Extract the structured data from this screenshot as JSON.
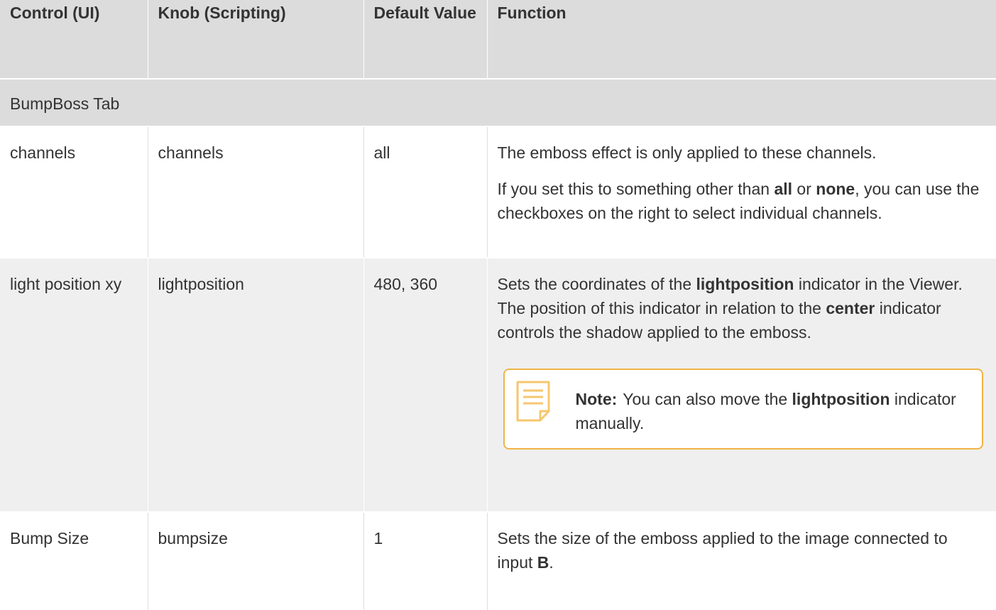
{
  "table": {
    "headers": {
      "control": "Control (UI)",
      "knob": "Knob (Scripting)",
      "default": "Default Value",
      "function": "Function"
    },
    "section_title": "BumpBoss Tab",
    "rows": [
      {
        "control": "channels",
        "knob": "channels",
        "default": "all",
        "function_p1": "The emboss effect is only applied to these channels.",
        "function_p2": {
          "t1": "If you set this to something other than ",
          "b1": "all",
          "t2": " or ",
          "b2": "none",
          "t3": ", you can use the checkboxes on the right to select individual channels."
        }
      },
      {
        "control": "light position xy",
        "knob": "lightposition",
        "default": "480, 360",
        "function_p1": {
          "t1": "Sets the coordinates of the ",
          "b1": "lightposition",
          "t2": " indicator in the Viewer. The position of this indicator in relation to the ",
          "b2": "center",
          "t3": " indicator controls the shadow applied to the emboss."
        },
        "note": {
          "label": "Note:",
          "t1": "You can also move the ",
          "b1": "lightposition",
          "t2": " indicator manually."
        }
      },
      {
        "control": "Bump Size",
        "knob": "bumpsize",
        "default": "1",
        "function_p1": {
          "t1": "Sets the size of the emboss applied to the image connected to input ",
          "b1": "B",
          "t2": "."
        }
      }
    ]
  },
  "icons": {
    "note_icon": "note-icon"
  },
  "colors": {
    "header_bg": "#dcdcdc",
    "note_border": "#f0b445",
    "alt_row_bg": "#efefef",
    "text": "#333333"
  }
}
